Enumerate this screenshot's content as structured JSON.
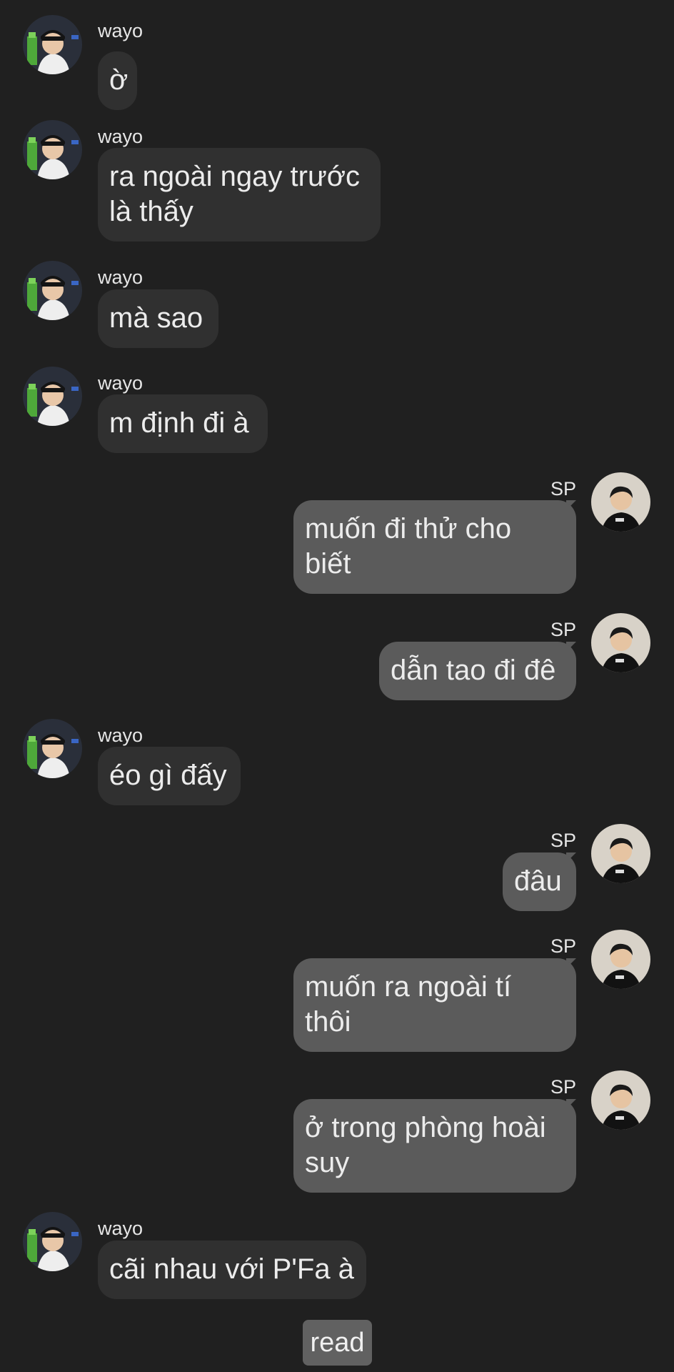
{
  "chat": {
    "messages": [
      {
        "sender": "wayo",
        "text": "ờ"
      },
      {
        "sender": "wayo",
        "text": "ra ngoài ngay trước\nlà thấy"
      },
      {
        "sender": "wayo",
        "text": "mà sao"
      },
      {
        "sender": "wayo",
        "text": "m định đi à"
      },
      {
        "sender": "SP",
        "text": "muốn đi thử cho\nbiết"
      },
      {
        "sender": "SP",
        "text": "dẫn tao đi đê"
      },
      {
        "sender": "wayo",
        "text": "éo gì đấy"
      },
      {
        "sender": "SP",
        "text": "đâu"
      },
      {
        "sender": "SP",
        "text": "muốn ra ngoài tí\nthôi"
      },
      {
        "sender": "SP",
        "text": "ở trong phòng hoài\nsuy"
      },
      {
        "sender": "wayo",
        "text": "cãi nhau với P'Fa à"
      }
    ],
    "read_label": "read"
  },
  "colors": {
    "background": "#202020",
    "incoming_bubble": "#303030",
    "outgoing_bubble": "#5b5b5b",
    "read_badge": "#616161"
  },
  "icons": {
    "incoming_avatar": "avatar-wayo-icon",
    "outgoing_avatar": "avatar-sp-icon"
  }
}
